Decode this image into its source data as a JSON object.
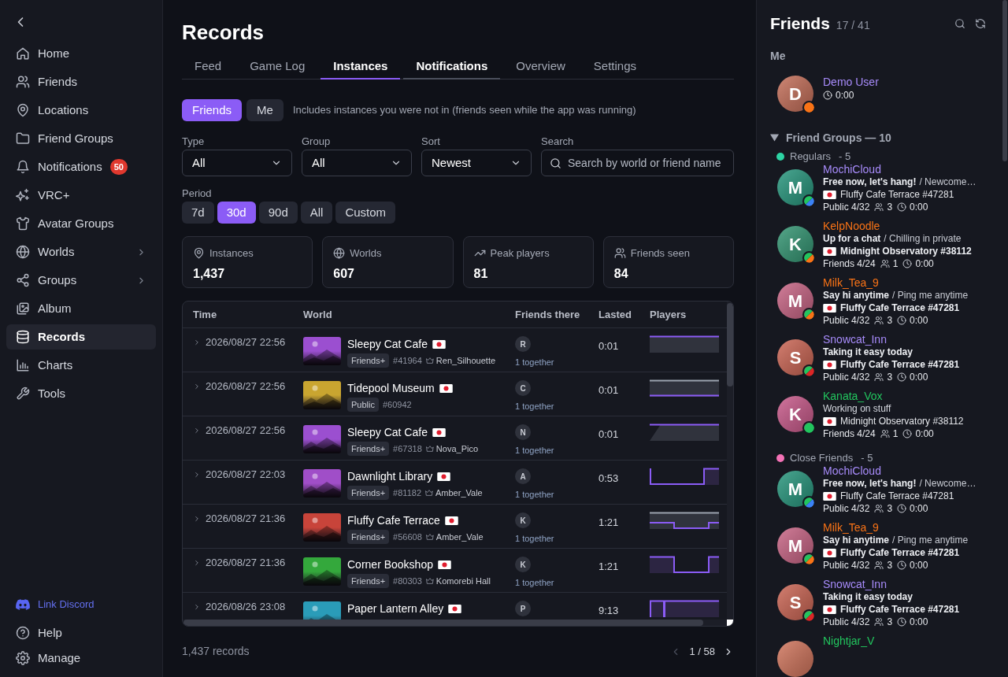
{
  "sidebar": {
    "items": [
      {
        "label": "Home",
        "selected": false,
        "submenu": false
      },
      {
        "label": "Friends",
        "selected": false,
        "submenu": false
      },
      {
        "label": "Locations",
        "selected": false,
        "submenu": false
      },
      {
        "label": "Friend Groups",
        "selected": false,
        "submenu": false
      },
      {
        "label": "Notifications",
        "selected": false,
        "submenu": false,
        "badge": "50"
      },
      {
        "label": "VRC+",
        "selected": false,
        "submenu": false
      },
      {
        "label": "Avatar Groups",
        "selected": false,
        "submenu": false
      },
      {
        "label": "Worlds",
        "selected": false,
        "submenu": true
      },
      {
        "label": "Groups",
        "selected": false,
        "submenu": true
      },
      {
        "label": "Album",
        "selected": false,
        "submenu": false
      },
      {
        "label": "Records",
        "selected": true,
        "submenu": false
      },
      {
        "label": "Charts",
        "selected": false,
        "submenu": false
      },
      {
        "label": "Tools",
        "selected": false,
        "submenu": false
      }
    ],
    "footer": [
      {
        "label": "Link Discord",
        "kind": "link"
      },
      {
        "label": "Help",
        "kind": "item"
      },
      {
        "label": "Manage",
        "kind": "item"
      }
    ]
  },
  "page": {
    "title": "Records"
  },
  "tabs": [
    {
      "label": "Feed",
      "selected": false,
      "hovered": false
    },
    {
      "label": "Game Log",
      "selected": false,
      "hovered": false
    },
    {
      "label": "Instances",
      "selected": true,
      "hovered": false
    },
    {
      "label": "Notifications",
      "selected": false,
      "hovered": true
    },
    {
      "label": "Overview",
      "selected": false,
      "hovered": false
    },
    {
      "label": "Settings",
      "selected": false,
      "hovered": false
    }
  ],
  "scope": {
    "options": [
      {
        "label": "Friends",
        "selected": true
      },
      {
        "label": "Me",
        "selected": false
      }
    ],
    "hint": "Includes instances you were not in (friends seen while the app was running)"
  },
  "filters": [
    {
      "kind": "select",
      "label": "Type",
      "value": "All"
    },
    {
      "kind": "select",
      "label": "Group",
      "value": "All"
    },
    {
      "kind": "select",
      "label": "Sort",
      "value": "Newest"
    },
    {
      "kind": "search",
      "label": "Search",
      "placeholder": "Search by world or friend name"
    }
  ],
  "period": {
    "label": "Period",
    "options": [
      {
        "label": "7d",
        "selected": false
      },
      {
        "label": "30d",
        "selected": true
      },
      {
        "label": "90d",
        "selected": false
      },
      {
        "label": "All",
        "selected": false
      },
      {
        "label": "Custom",
        "selected": false
      }
    ]
  },
  "stats": [
    {
      "label": "Instances",
      "value": "1,437"
    },
    {
      "label": "Worlds",
      "value": "607"
    },
    {
      "label": "Peak players",
      "value": "81"
    },
    {
      "label": "Friends seen",
      "value": "84"
    }
  ],
  "table": {
    "columns": [
      "Time",
      "World",
      "Friends there",
      "Lasted",
      "Players"
    ],
    "rows": [
      {
        "expanded": false,
        "time": "2026/08/27 22:56",
        "world": "Sleepy Cat Cafe",
        "thumbnail": {
          "color": "#9b4fd0"
        },
        "access": "Friends+",
        "instance": "#41964",
        "owner": "Ren_Silhouette",
        "friends": [
          {
            "initial": "R"
          }
        ],
        "together": "1 together",
        "lasted": "0:01"
      },
      {
        "expanded": false,
        "time": "2026/08/27 22:56",
        "world": "Tidepool Museum",
        "thumbnail": {
          "color": "#c9a530"
        },
        "access": "Public",
        "instance": "#60942",
        "friends": [
          {
            "initial": "C"
          }
        ],
        "together": "1 together",
        "lasted": "0:01"
      },
      {
        "expanded": false,
        "time": "2026/08/27 22:56",
        "world": "Sleepy Cat Cafe",
        "thumbnail": {
          "color": "#9b4fd0"
        },
        "access": "Friends+",
        "instance": "#67318",
        "owner": "Nova_Pico",
        "friends": [
          {
            "initial": "N"
          }
        ],
        "together": "1 together",
        "lasted": "0:01"
      },
      {
        "expanded": false,
        "time": "2026/08/27 22:03",
        "world": "Dawnlight Library",
        "thumbnail": {
          "color": "#a04ec8"
        },
        "access": "Friends+",
        "instance": "#81182",
        "owner": "Amber_Vale",
        "friends": [
          {
            "initial": "A"
          }
        ],
        "together": "1 together",
        "lasted": "0:53"
      },
      {
        "expanded": false,
        "time": "2026/08/27 21:36",
        "world": "Fluffy Cafe Terrace",
        "thumbnail": {
          "color": "#c8443a"
        },
        "access": "Friends+",
        "instance": "#56608",
        "owner": "Amber_Vale",
        "friends": [
          {
            "initial": "K"
          }
        ],
        "together": "1 together",
        "lasted": "1:21"
      },
      {
        "expanded": false,
        "time": "2026/08/27 21:36",
        "world": "Corner Bookshop",
        "thumbnail": {
          "color": "#34a83c"
        },
        "access": "Friends+",
        "instance": "#80303",
        "owner": "Komorebi Hall",
        "friends": [
          {
            "initial": "K"
          }
        ],
        "together": "1 together",
        "lasted": "1:21"
      },
      {
        "expanded": false,
        "time": "2026/08/26 23:08",
        "world": "Paper Lantern Alley",
        "thumbnail": {
          "color": "#2a9cb8"
        },
        "friends": [
          {
            "initial": "P"
          }
        ],
        "lasted": "9:13"
      }
    ]
  },
  "footer": {
    "count": "1,437 records",
    "page": "1 / 58",
    "prev_enabled": false,
    "next_enabled": true
  },
  "friends_panel": {
    "title": "Friends",
    "count": "17 / 41",
    "me_label": "Me",
    "me": {
      "name": "Demo User",
      "color": "#a78bfa",
      "avatar": {
        "initial": "D",
        "color": "#c8745f"
      },
      "status_dot": {
        "color": "#f97316",
        "split": false
      },
      "time": "0:00"
    },
    "groups_header": {
      "label": "Friend Groups — 10",
      "expanded": true
    },
    "groups": [
      {
        "name": "Regulars",
        "count": "- 5",
        "color": "#2dd4a4",
        "friends": [
          {
            "name": "MochiCloud",
            "color": "#a78bfa",
            "avatar": {
              "initial": "M",
              "color": "#2e9b82"
            },
            "status_dot": {
              "color": "#3b82f6",
              "split": true
            },
            "status": "Free now, let's hang!",
            "status_bold": true,
            "note": "/ Newcome…",
            "location": "Fluffy Cafe Terrace #47281",
            "location_bold": false,
            "access": "Public 4/32",
            "friends_count": "3",
            "time": "0:00"
          },
          {
            "name": "KelpNoodle",
            "color": "#f97316",
            "avatar": {
              "initial": "K",
              "color": "#3a9a78"
            },
            "status_dot": {
              "color": "#f97316",
              "split": true
            },
            "status": "Up for a chat",
            "status_bold": true,
            "note": "/ Chilling in private",
            "location": "Midnight Observatory #38112",
            "location_bold": true,
            "access": "Friends 4/24",
            "friends_count": "1",
            "time": "0:00"
          },
          {
            "name": "Milk_Tea_9",
            "color": "#f97316",
            "avatar": {
              "initial": "M",
              "color": "#cc6a8a"
            },
            "status_dot": {
              "color": "#f97316",
              "split": true
            },
            "status": "Say hi anytime",
            "status_bold": true,
            "note": "/ Ping me anytime",
            "location": "Fluffy Cafe Terrace #47281",
            "location_bold": true,
            "access": "Public 4/32",
            "friends_count": "3",
            "time": "0:00"
          },
          {
            "name": "Snowcat_Inn",
            "color": "#a78bfa",
            "avatar": {
              "initial": "S",
              "color": "#cf6b5a"
            },
            "status_dot": {
              "color": "#dc2626",
              "split": true
            },
            "status": "Taking it easy today",
            "status_bold": true,
            "location": "Fluffy Cafe Terrace #47281",
            "location_bold": true,
            "access": "Public 4/32",
            "friends_count": "3",
            "time": "0:00"
          },
          {
            "name": "Kanata_Vox",
            "color": "#22c55e",
            "avatar": {
              "initial": "K",
              "color": "#cc5f8f"
            },
            "status_dot": {
              "color": "#22c55e",
              "split": false
            },
            "status": "Working on stuff",
            "status_bold": false,
            "location": "Midnight Observatory #38112",
            "location_bold": false,
            "access": "Friends 4/24",
            "friends_count": "1",
            "time": "0:00"
          }
        ]
      },
      {
        "name": "Close Friends",
        "count": "- 5",
        "color": "#f472b6",
        "friends": [
          {
            "name": "MochiCloud",
            "color": "#a78bfa",
            "avatar": {
              "initial": "M",
              "color": "#2e9b82"
            },
            "status_dot": {
              "color": "#3b82f6",
              "split": true
            },
            "status": "Free now, let's hang!",
            "status_bold": true,
            "note": "/ Newcome…",
            "location": "Fluffy Cafe Terrace #47281",
            "location_bold": false,
            "access": "Public 4/32",
            "friends_count": "3",
            "time": "0:00"
          },
          {
            "name": "Milk_Tea_9",
            "color": "#f97316",
            "avatar": {
              "initial": "M",
              "color": "#cc6a8a"
            },
            "status_dot": {
              "color": "#f97316",
              "split": true
            },
            "status": "Say hi anytime",
            "status_bold": true,
            "note": "/ Ping me anytime",
            "location": "Fluffy Cafe Terrace #47281",
            "location_bold": true,
            "access": "Public 4/32",
            "friends_count": "3",
            "time": "0:00"
          },
          {
            "name": "Snowcat_Inn",
            "color": "#a78bfa",
            "avatar": {
              "initial": "S",
              "color": "#cf6b5a"
            },
            "status_dot": {
              "color": "#dc2626",
              "split": true
            },
            "status": "Taking it easy today",
            "status_bold": true,
            "location": "Fluffy Cafe Terrace #47281",
            "location_bold": true,
            "access": "Public 4/32",
            "friends_count": "3",
            "time": "0:00"
          },
          {
            "name": "Nightjar_V",
            "color": "#22c55e",
            "avatar": {
              "color": "#d47a62"
            }
          }
        ]
      }
    ]
  }
}
